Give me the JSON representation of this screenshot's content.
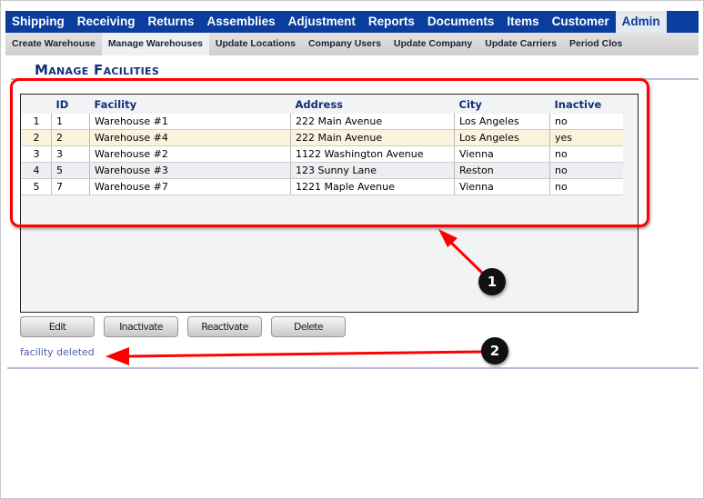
{
  "nav": {
    "items": [
      "Shipping",
      "Receiving",
      "Returns",
      "Assemblies",
      "Adjustment",
      "Reports",
      "Documents",
      "Items",
      "Customer",
      "Admin"
    ],
    "active": "Admin"
  },
  "subnav": {
    "items": [
      "Create Warehouse",
      "Manage Warehouses",
      "Update Locations",
      "Company Users",
      "Update Company",
      "Update Carriers",
      "Period Clos"
    ],
    "active": "Manage Warehouses"
  },
  "page_title": "Manage Facilities",
  "grid": {
    "columns": [
      "",
      "ID",
      "Facility",
      "Address",
      "City",
      "Inactive"
    ],
    "rows": [
      [
        "1",
        "1",
        "Warehouse #1",
        "222 Main Avenue",
        "Los Angeles",
        "no"
      ],
      [
        "2",
        "2",
        "Warehouse #4",
        "222 Main Avenue",
        "Los Angeles",
        "yes"
      ],
      [
        "3",
        "3",
        "Warehouse #2",
        "1122 Washington Avenue",
        "Vienna",
        "no"
      ],
      [
        "4",
        "5",
        "Warehouse #3",
        "123 Sunny Lane",
        "Reston",
        "no"
      ],
      [
        "5",
        "7",
        "Warehouse #7",
        "1221 Maple Avenue",
        "Vienna",
        "no"
      ]
    ],
    "selected_row": 1
  },
  "buttons": {
    "edit": "Edit",
    "inactivate": "Inactivate",
    "reactivate": "Reactivate",
    "delete": "Delete"
  },
  "status": "facility deleted",
  "annotations": [
    "1",
    "2"
  ],
  "colors": {
    "nav": "#0a3d9e",
    "annotation": "#ff0000"
  }
}
